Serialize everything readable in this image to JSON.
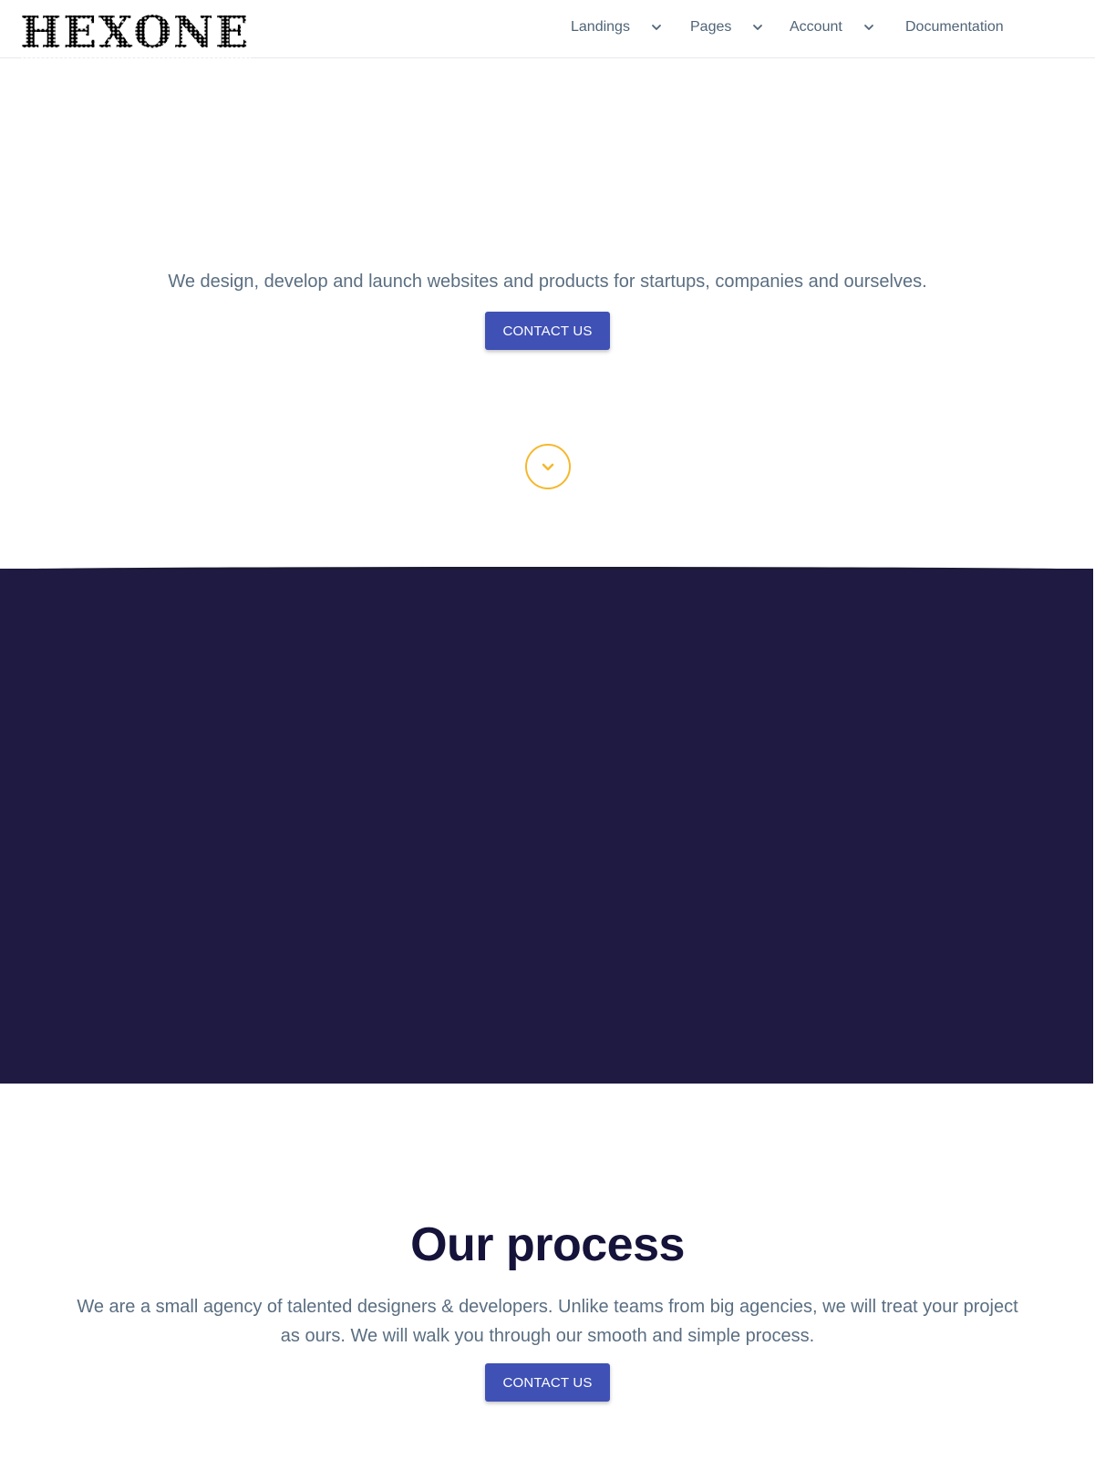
{
  "brand": {
    "logo_text": "HEXONE"
  },
  "nav": {
    "items": [
      {
        "label": "Landings",
        "has_dropdown": true,
        "icon": "chevron-down-icon"
      },
      {
        "label": "Pages",
        "has_dropdown": true,
        "icon": "chevron-down-icon"
      },
      {
        "label": "Account",
        "has_dropdown": true,
        "icon": "chevron-down-icon"
      },
      {
        "label": "Documentation",
        "has_dropdown": false
      }
    ]
  },
  "hero": {
    "subtitle": "We design, develop and launch websites and products for startups, companies and ourselves.",
    "cta_label": "CONTACT US",
    "scroll_icon": "chevron-down-circle-icon"
  },
  "process": {
    "title": "Our process",
    "text": "We are a small agency of talented designers & developers. Unlike teams from big agencies, we will treat your project as ours. We will walk you through our smooth and simple process.",
    "cta_label": "CONTACT US"
  },
  "colors": {
    "primary_button": "#3f51b5",
    "accent_yellow": "#f5b82e",
    "dark_band": "#1e1a42",
    "heading": "#15133a",
    "body_text": "#5a6e81"
  }
}
